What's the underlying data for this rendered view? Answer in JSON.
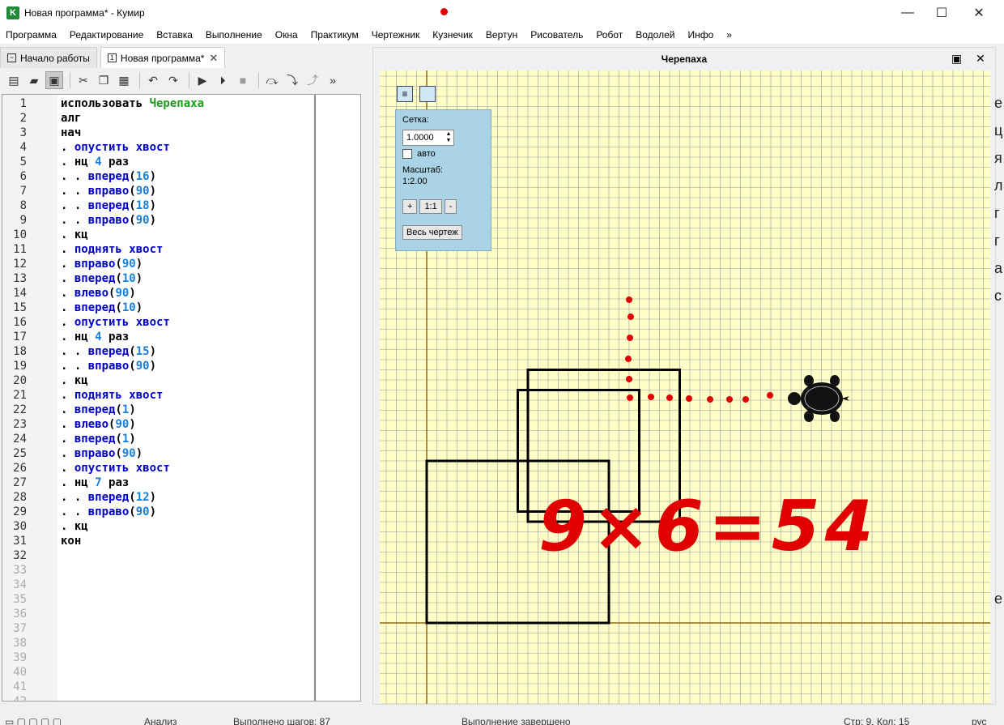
{
  "window": {
    "title": "Новая программа* - Кумир",
    "app_icon_letter": "K"
  },
  "menu": [
    "Программа",
    "Редактирование",
    "Вставка",
    "Выполнение",
    "Окна",
    "Практикум",
    "Чертежник",
    "Кузнечик",
    "Вертун",
    "Рисователь",
    "Робот",
    "Водолей",
    "Инфо",
    "»"
  ],
  "tabs": [
    {
      "label": "Начало работы",
      "active": false
    },
    {
      "label": "Новая программа*",
      "active": true
    }
  ],
  "toolbar": {
    "overflow": "»",
    "icons": [
      "new-file-icon",
      "open-folder-icon",
      "save-icon",
      "cut-icon",
      "copy-icon",
      "paste-icon",
      "undo-icon",
      "redo-icon",
      "run-icon",
      "run-step-icon",
      "stop-icon",
      "step-over-icon",
      "step-into-icon",
      "step-out-icon"
    ]
  },
  "editor": {
    "total_lines": 42,
    "code": [
      [
        [
          "",
          "kw-black",
          "использовать "
        ],
        [
          "",
          "kw-green",
          "Черепаха"
        ]
      ],
      [
        [
          "",
          "kw-black",
          "алг"
        ]
      ],
      [
        [
          "",
          "kw-black",
          "нач"
        ]
      ],
      [
        [
          "dot",
          "dot",
          ". "
        ],
        [
          "",
          "kw-blue",
          "опустить хвост"
        ]
      ],
      [
        [
          "dot",
          "dot",
          ". "
        ],
        [
          "",
          "kw-black",
          "нц "
        ],
        [
          "",
          "num",
          "4"
        ],
        [
          "",
          "kw-black",
          " раз"
        ]
      ],
      [
        [
          "dot",
          "dot",
          ". . "
        ],
        [
          "",
          "kw-blue",
          "вперед"
        ],
        [
          "",
          "kw-black",
          "("
        ],
        [
          "",
          "num",
          "16"
        ],
        [
          "",
          "kw-black",
          ")"
        ]
      ],
      [
        [
          "dot",
          "dot",
          ". . "
        ],
        [
          "",
          "kw-blue",
          "вправо"
        ],
        [
          "",
          "kw-black",
          "("
        ],
        [
          "",
          "num",
          "90"
        ],
        [
          "",
          "kw-black",
          ")"
        ]
      ],
      [
        [
          "dot",
          "dot",
          ". . "
        ],
        [
          "",
          "kw-blue",
          "вперед"
        ],
        [
          "",
          "kw-black",
          "("
        ],
        [
          "",
          "num",
          "18"
        ],
        [
          "",
          "kw-black",
          ")"
        ]
      ],
      [
        [
          "dot",
          "dot",
          ". . "
        ],
        [
          "",
          "kw-blue",
          "вправо"
        ],
        [
          "",
          "kw-black",
          "("
        ],
        [
          "",
          "num",
          "90"
        ],
        [
          "",
          "kw-black",
          ")"
        ]
      ],
      [
        [
          "dot",
          "dot",
          ". "
        ],
        [
          "",
          "kw-black",
          "кц"
        ]
      ],
      [
        [
          "dot",
          "dot",
          ". "
        ],
        [
          "",
          "kw-blue",
          "поднять хвост"
        ]
      ],
      [
        [
          "dot",
          "dot",
          ". "
        ],
        [
          "",
          "kw-blue",
          "вправо"
        ],
        [
          "",
          "kw-black",
          "("
        ],
        [
          "",
          "num",
          "90"
        ],
        [
          "",
          "kw-black",
          ")"
        ]
      ],
      [
        [
          "dot",
          "dot",
          ". "
        ],
        [
          "",
          "kw-blue",
          "вперед"
        ],
        [
          "",
          "kw-black",
          "("
        ],
        [
          "",
          "num",
          "10"
        ],
        [
          "",
          "kw-black",
          ")"
        ]
      ],
      [
        [
          "dot",
          "dot",
          ". "
        ],
        [
          "",
          "kw-blue",
          "влево"
        ],
        [
          "",
          "kw-black",
          "("
        ],
        [
          "",
          "num",
          "90"
        ],
        [
          "",
          "kw-black",
          ")"
        ]
      ],
      [
        [
          "dot",
          "dot",
          ". "
        ],
        [
          "",
          "kw-blue",
          "вперед"
        ],
        [
          "",
          "kw-black",
          "("
        ],
        [
          "",
          "num",
          "10"
        ],
        [
          "",
          "kw-black",
          ")"
        ]
      ],
      [
        [
          "dot",
          "dot",
          ". "
        ],
        [
          "",
          "kw-blue",
          "опустить хвост"
        ]
      ],
      [
        [
          "dot",
          "dot",
          ". "
        ],
        [
          "",
          "kw-black",
          "нц "
        ],
        [
          "",
          "num",
          "4"
        ],
        [
          "",
          "kw-black",
          " раз"
        ]
      ],
      [
        [
          "dot",
          "dot",
          ". . "
        ],
        [
          "",
          "kw-blue",
          "вперед"
        ],
        [
          "",
          "kw-black",
          "("
        ],
        [
          "",
          "num",
          "15"
        ],
        [
          "",
          "kw-black",
          ")"
        ]
      ],
      [
        [
          "dot",
          "dot",
          ". . "
        ],
        [
          "",
          "kw-blue",
          "вправо"
        ],
        [
          "",
          "kw-black",
          "("
        ],
        [
          "",
          "num",
          "90"
        ],
        [
          "",
          "kw-black",
          ")"
        ]
      ],
      [
        [
          "dot",
          "dot",
          ". "
        ],
        [
          "",
          "kw-black",
          "кц"
        ]
      ],
      [
        [
          "dot",
          "dot",
          ". "
        ],
        [
          "",
          "kw-blue",
          "поднять хвост"
        ]
      ],
      [
        [
          "dot",
          "dot",
          ". "
        ],
        [
          "",
          "kw-blue",
          "вперед"
        ],
        [
          "",
          "kw-black",
          "("
        ],
        [
          "",
          "num",
          "1"
        ],
        [
          "",
          "kw-black",
          ")"
        ]
      ],
      [
        [
          "dot",
          "dot",
          ". "
        ],
        [
          "",
          "kw-blue",
          "влево"
        ],
        [
          "",
          "kw-black",
          "("
        ],
        [
          "",
          "num",
          "90"
        ],
        [
          "",
          "kw-black",
          ")"
        ]
      ],
      [
        [
          "dot",
          "dot",
          ". "
        ],
        [
          "",
          "kw-blue",
          "вперед"
        ],
        [
          "",
          "kw-black",
          "("
        ],
        [
          "",
          "num",
          "1"
        ],
        [
          "",
          "kw-black",
          ")"
        ]
      ],
      [
        [
          "dot",
          "dot",
          ". "
        ],
        [
          "",
          "kw-blue",
          "вправо"
        ],
        [
          "",
          "kw-black",
          "("
        ],
        [
          "",
          "num",
          "90"
        ],
        [
          "",
          "kw-black",
          ")"
        ]
      ],
      [
        [
          "dot",
          "dot",
          ". "
        ],
        [
          "",
          "kw-blue",
          "опустить хвост"
        ]
      ],
      [
        [
          "dot",
          "dot",
          ". "
        ],
        [
          "",
          "kw-black",
          "нц "
        ],
        [
          "",
          "num",
          "7"
        ],
        [
          "",
          "kw-black",
          " раз"
        ]
      ],
      [
        [
          "dot",
          "dot",
          ". . "
        ],
        [
          "",
          "kw-blue",
          "вперед"
        ],
        [
          "",
          "kw-black",
          "("
        ],
        [
          "",
          "num",
          "12"
        ],
        [
          "",
          "kw-black",
          ")"
        ]
      ],
      [
        [
          "dot",
          "dot",
          ". . "
        ],
        [
          "",
          "kw-blue",
          "вправо"
        ],
        [
          "",
          "kw-black",
          "("
        ],
        [
          "",
          "num",
          "90"
        ],
        [
          "",
          "kw-black",
          ")"
        ]
      ],
      [
        [
          "dot",
          "dot",
          ". "
        ],
        [
          "",
          "kw-black",
          "кц"
        ]
      ],
      [
        [
          "",
          "kw-black",
          "кон"
        ]
      ]
    ]
  },
  "turtle_window": {
    "title": "Черепаха",
    "grid_label": "Сетка:",
    "grid_value": "1.0000",
    "auto_label": "авто",
    "scale_label": "Масштаб:",
    "scale_value": "1:2.00",
    "zoom_plus": "+",
    "zoom_one": "1:1",
    "zoom_minus": "-",
    "whole_drawing": "Весь чертеж",
    "annotation": "9×6=54",
    "colors": {
      "canvas_bg": "#ffffc8",
      "grid": "#9a9a9a",
      "axis": "#8b6914",
      "stroke": "#000000",
      "annotation": "#e00000"
    }
  },
  "right_strip": [
    "е",
    "ц",
    "я",
    "л",
    "г",
    "г",
    "а",
    "с",
    "",
    "",
    "",
    "",
    "",
    "",
    "",
    "",
    "",
    "",
    "е"
  ],
  "status": {
    "analysis": "Анализ",
    "steps": "Выполнено шагов: 87",
    "state": "Выполнение завершено",
    "position": "Стр: 9, Кол: 15",
    "lang": "рус"
  }
}
